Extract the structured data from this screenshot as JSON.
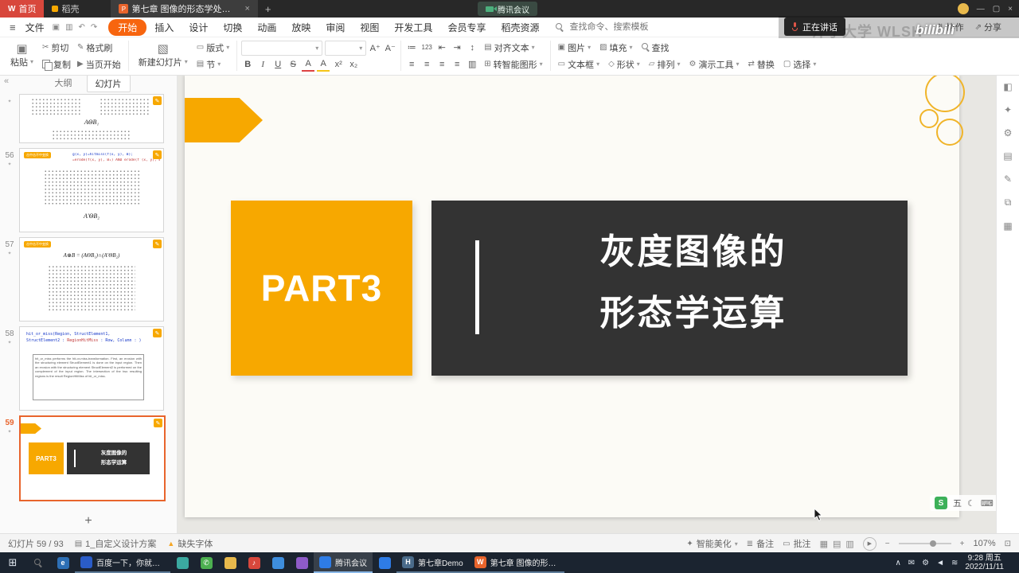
{
  "colors": {
    "accent_orange": "#F7A800",
    "menu_active_orange": "#F7650F",
    "home_tab_red": "#D8473C",
    "dark_box": "#333333",
    "thumb_selected_border": "#E8642C",
    "taskbar_bg": "#1B2430"
  },
  "titlebar": {
    "home_tab": "首页",
    "docer_tab": "稻壳",
    "doc_tab": "第七章 图像的形态学处理PPT",
    "new_tab_plus": "+",
    "meeting_pill": "腾讯会议",
    "min": "—",
    "max": "▢",
    "close": "×"
  },
  "menubar": {
    "file_menu": "文件",
    "items": [
      "开始",
      "插入",
      "设计",
      "切换",
      "动画",
      "放映",
      "审阅",
      "视图",
      "开发工具",
      "会员专享",
      "稻壳资源"
    ],
    "search_placeholder": "查找命令、搜索模板",
    "collab": "协作",
    "share": "分享"
  },
  "toolbar": {
    "paste": "粘贴",
    "cut": "剪切",
    "copy": "复制",
    "format_painter": "格式刷",
    "from_current": "当页开始",
    "new_slide": "新建幻灯片",
    "layout": "版式",
    "section": "节",
    "align_text": "对齐文本",
    "to_smart_graphic": "转智能图形",
    "picture": "图片",
    "fill": "填充",
    "find": "查找",
    "textbox": "文本框",
    "shape": "形状",
    "arrange": "排列",
    "present_tools": "演示工具",
    "replace": "替换",
    "select": "选择"
  },
  "overlay": {
    "speaking": "正在讲话",
    "watermark": "汗子大学 WLSH",
    "bilibili": "bilibili"
  },
  "sidebar": {
    "tab_outline": "大纲",
    "tab_slides": "幻灯片",
    "add_slide": "+",
    "thumbs": {
      "t55": {
        "formula": "AΘB₁"
      },
      "t56": {
        "num": "56",
        "title": "击中击不中变换",
        "code1": "g(x, y)=hitmiss(f(x, y), B);",
        "code2": "=erode(f(x, y), B₁) AND erode(f′(x, y), B₂)",
        "formula": "A′ΘB₂"
      },
      "t57": {
        "num": "57",
        "title": "击中击不中变换",
        "formula": "A⊛B = (AΘB₁)∩(A′ΘB₂)"
      },
      "t58": {
        "num": "58",
        "code1": "hit_or_miss(Region, StructElement1,",
        "code2_pre": "StructElement2 : ",
        "code2_red": "RegionHitMiss",
        "code2_post": " : Row, Column : )",
        "desc": "hit_or_miss performs the hit-or-miss-transformation. First, an erosion with the structuring element StructElement1 is done on the input region. Then an erosion with the structuring element StructElement2 is performed on the complement of the input region. The intersection of the two resulting regions is the result RegionHitMiss of hit_or_miss."
      },
      "t59": {
        "num": "59",
        "part": "PART3",
        "line1": "灰度图像的",
        "line2": "形态学运算"
      }
    }
  },
  "slide": {
    "part_label": "PART3",
    "title_line1": "灰度图像的",
    "title_line2": "形态学运算"
  },
  "canvas_corner": {
    "logo": "S",
    "wu": "五"
  },
  "statusbar": {
    "slide_counter": "幻灯片 59 / 93",
    "design_scheme": "1_自定义设计方案",
    "missing_font": "缺失字体",
    "beautify": "智能美化",
    "notes": "备注",
    "comments": "批注",
    "zoom_level": "107%"
  },
  "taskbar": {
    "task_baidu": "百度一下，你就知...",
    "task_meeting": "腾讯会议",
    "task_demo": "第七章Demo",
    "task_ppt": "第七章 图像的形态...",
    "time": "9:28",
    "weekday": "周五",
    "date": "2022/11/11"
  },
  "icons": {
    "dropdown": "▾",
    "hamburger": "≡",
    "save": "▣",
    "print": "▥",
    "undo": "↶",
    "redo": "↷",
    "cut": "✂",
    "painter": "✎",
    "play": "▶",
    "new_slide": "▧",
    "layout": "▭",
    "section": "▤",
    "font_grow": "A⁺",
    "font_shrink": "A⁻",
    "bold": "B",
    "italic": "I",
    "underline": "U",
    "strike": "S",
    "font_color": "A",
    "highlight": "A",
    "superscript": "x²",
    "subscript": "x₂",
    "bullets": "≔",
    "numbering": "123",
    "indent_dec": "⇤",
    "indent_inc": "⇥",
    "line_spacing": "↕",
    "align": "≡",
    "align_text": "▤",
    "smart_graphic": "⊞",
    "picture": "▣",
    "fill": "▨",
    "textbox": "▭",
    "shape": "◇",
    "arrange": "▱",
    "present_tools": "⚙",
    "replace": "⇄",
    "select": "▢",
    "collapse": "«",
    "star": "✦",
    "moon": "☾",
    "keyboard": "⌨",
    "mouse": "▯",
    "grid": "▦",
    "warning": "▲",
    "scheme": "▤",
    "wand": "✦",
    "notes": "≣",
    "comments": "▭",
    "view_normal": "▦",
    "view_sorter": "▤",
    "view_read": "▥",
    "minus": "−",
    "plus": "+",
    "fit": "⊡",
    "start": "⊞",
    "chevron_up": "∧",
    "mail": "✉",
    "gear": "⚙",
    "volume": "◄",
    "network": "≋",
    "collab": "⇅",
    "share": "⇗",
    "browser": "e",
    "wps": "W",
    "music": "♪",
    "chat": "✆",
    "halcon": "H",
    "panel1": "◧",
    "panel2": "✦",
    "panel3": "⚙",
    "panel4": "▤",
    "panel5": "✎",
    "panel6": "⧉",
    "panel7": "▦"
  }
}
